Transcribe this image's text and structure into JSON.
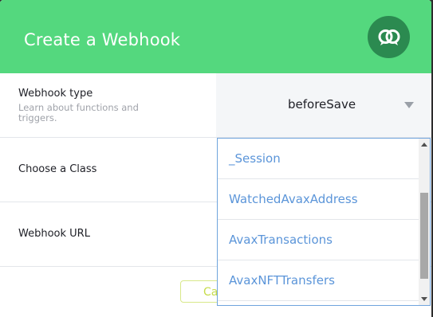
{
  "header": {
    "title": "Create a Webhook",
    "icon": "webhook-rings-icon"
  },
  "fields": {
    "webhook_type": {
      "label": "Webhook type",
      "description": "Learn about functions and triggers.",
      "value": "beforeSave"
    },
    "class": {
      "label": "Choose a Class"
    },
    "url": {
      "label": "Webhook URL"
    }
  },
  "dropdown": {
    "options": [
      "_Session",
      "WatchedAvaxAddress",
      "AvaxTransactions",
      "AvaxNFTTransfers"
    ]
  },
  "footer": {
    "cancel_label": "Ca"
  },
  "colors": {
    "header_bg": "#54d87e",
    "icon_bg": "#2b8a50",
    "option_text": "#5b95d9",
    "cancel_border": "#d8e88a"
  }
}
